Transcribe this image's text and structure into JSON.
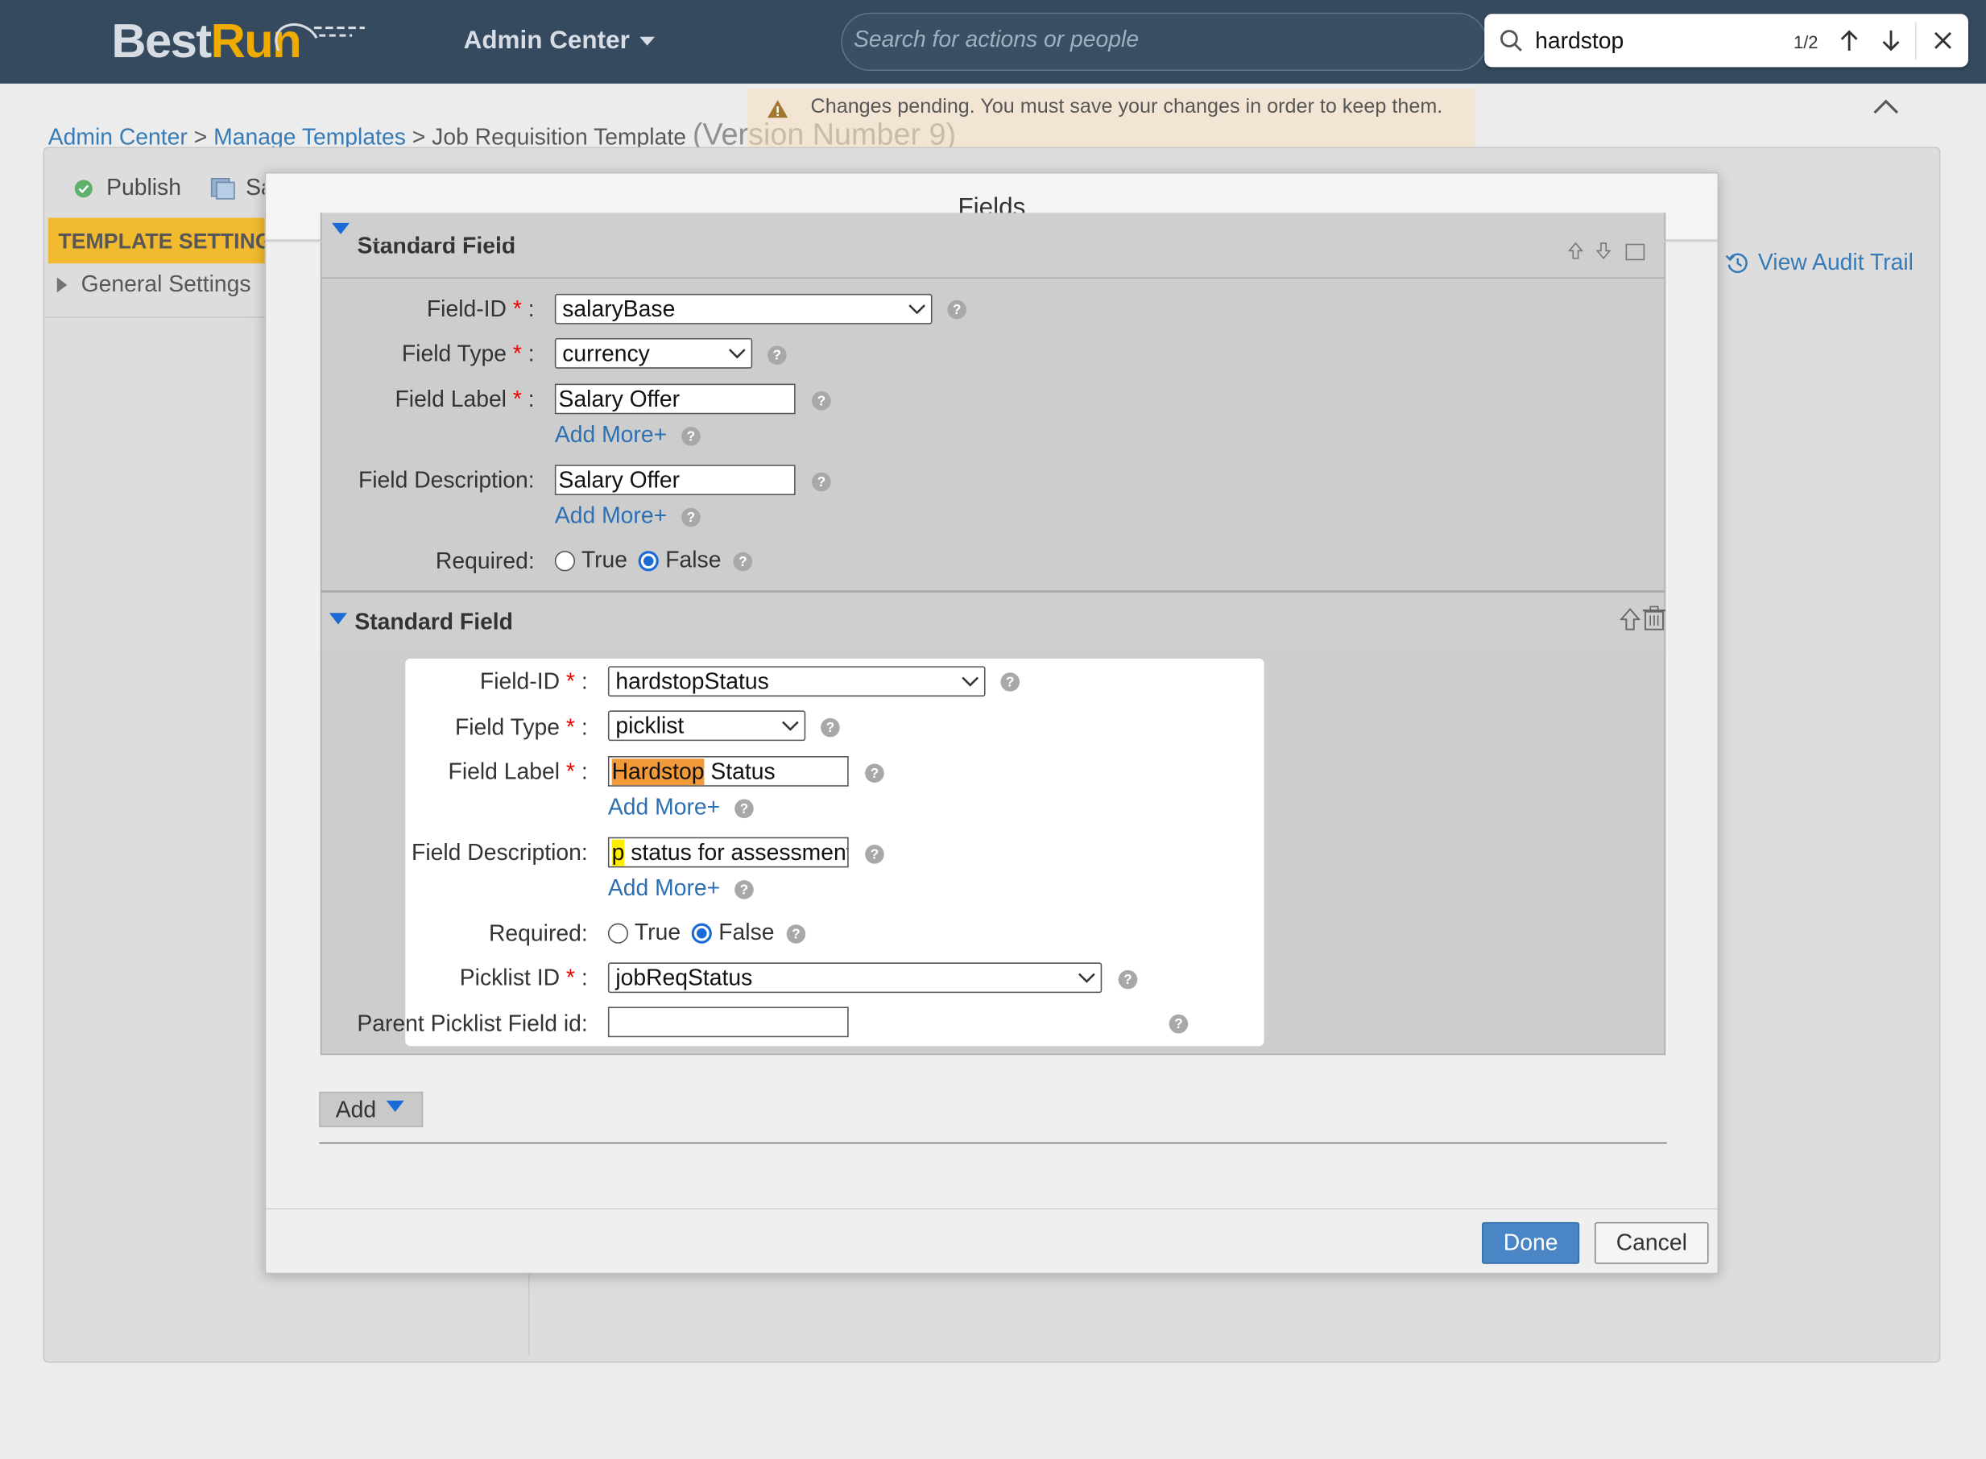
{
  "header": {
    "logo_best": "Best",
    "logo_run": "Run",
    "admin_center": "Admin Center",
    "search_placeholder": "Search for actions or people"
  },
  "find_bar": {
    "query": "hardstop",
    "count": "1/2"
  },
  "breadcrumb": {
    "admin_center": "Admin Center",
    "sep": ">",
    "manage_templates": "Manage Templates",
    "current": "Job Requisition Template",
    "version": "(Version Number 9)"
  },
  "pending_notice": "Changes pending. You must save your changes in order to keep them.",
  "toolbar": {
    "publish": "Publish",
    "save": "Sa"
  },
  "sidebar": {
    "template_settings": "TEMPLATE SETTINGS",
    "general_settings": "General Settings"
  },
  "view_audit_trail": "View Audit Trail",
  "modal": {
    "title": "Fields",
    "section1": {
      "title": "Standard Field",
      "field_id_label": "Field-ID",
      "field_id_value": "salaryBase",
      "field_type_label": "Field Type",
      "field_type_value": "currency",
      "field_label_label": "Field Label",
      "field_label_value": "Salary Offer",
      "add_more": "Add More+",
      "field_desc_label": "Field Description:",
      "field_desc_value": "Salary Offer",
      "required_label": "Required:",
      "true_label": "True",
      "false_label": "False"
    },
    "section2": {
      "title": "Standard Field",
      "field_id_label": "Field-ID",
      "field_id_value": "hardstopStatus",
      "field_type_label": "Field Type",
      "field_type_value": "picklist",
      "field_label_label": "Field Label",
      "field_label_match": "Hardstop",
      "field_label_rest": " Status",
      "add_more": "Add More+",
      "field_desc_label": "Field Description:",
      "field_desc_match": "p",
      "field_desc_rest": " status for assessment",
      "required_label": "Required:",
      "true_label": "True",
      "false_label": "False",
      "picklist_label": "Picklist ID",
      "picklist_value": "jobReqStatus",
      "parent_label": "Parent Picklist Field id:",
      "parent_value": ""
    },
    "req_mark": "*",
    "colon": ":",
    "help_glyph": "?",
    "add_button": "Add",
    "done_button": "Done",
    "cancel_button": "Cancel"
  },
  "colors": {
    "header_bg": "#354a5f",
    "brand_orange": "#f0ab00",
    "link_blue": "#0a5fa8",
    "primary_button": "#4a86c5",
    "find_highlight_current": "#f29a3a",
    "find_highlight_other": "#ffee00"
  }
}
